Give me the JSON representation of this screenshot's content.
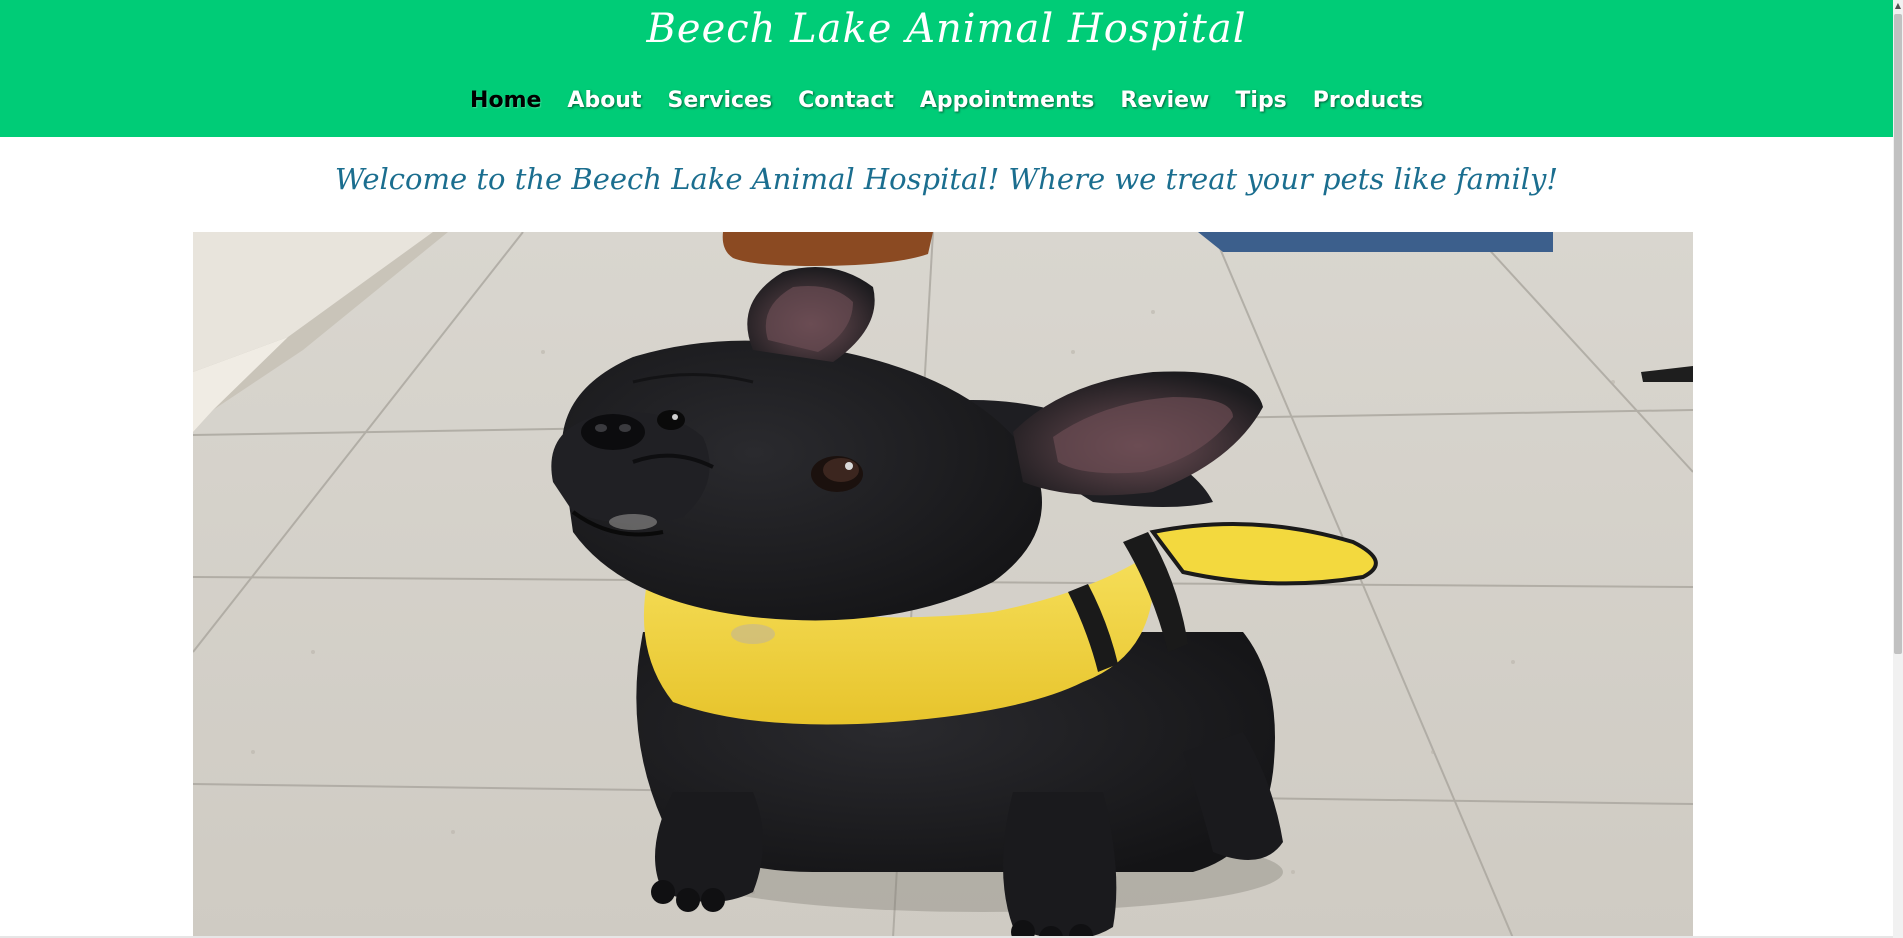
{
  "header": {
    "title": "Beech Lake Animal Hospital",
    "background_color": "#00cc77"
  },
  "nav": {
    "items": [
      {
        "label": "Home",
        "active": true
      },
      {
        "label": "About",
        "active": false
      },
      {
        "label": "Services",
        "active": false
      },
      {
        "label": "Contact",
        "active": false
      },
      {
        "label": "Appointments",
        "active": false
      },
      {
        "label": "Review",
        "active": false
      },
      {
        "label": "Tips",
        "active": false
      },
      {
        "label": "Products",
        "active": false
      }
    ]
  },
  "main": {
    "welcome_text": "Welcome to the Beech Lake Animal Hospital! Where we treat your pets like family!",
    "welcome_color": "#1b6e8f",
    "hero_image": {
      "subject": "black french bulldog wearing a yellow bumblebee costume on a tiled floor"
    }
  }
}
